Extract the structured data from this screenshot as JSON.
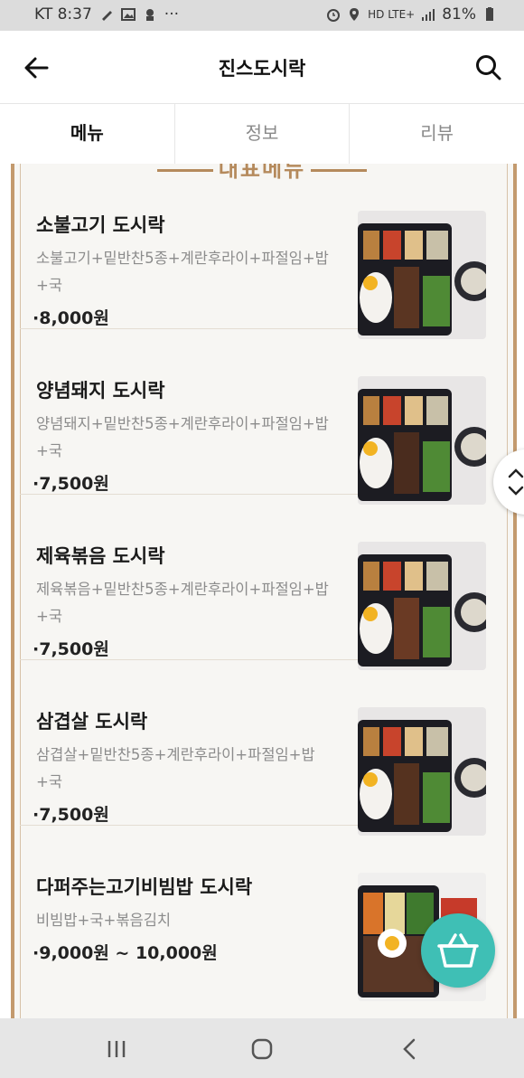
{
  "status_bar": {
    "carrier_time": "KT 8:37",
    "dots": "···",
    "network": "HD LTE+",
    "battery": "81%"
  },
  "header": {
    "title": "진스도시락"
  },
  "tabs": [
    {
      "label": "메뉴",
      "active": true
    },
    {
      "label": "정보",
      "active": false
    },
    {
      "label": "리뷰",
      "active": false
    }
  ],
  "section_banner": "대표메뉴",
  "menu_items": [
    {
      "name": "소불고기 도시락",
      "desc": "소불고기+밑반찬5종+계란후라이+파절임+밥+국",
      "price": "8,000원"
    },
    {
      "name": "양념돼지 도시락",
      "desc": "양념돼지+밑반찬5종+계란후라이+파절임+밥+국",
      "price": "7,500원"
    },
    {
      "name": "제육볶음 도시락",
      "desc": "제육볶음+밑반찬5종+계란후라이+파절임+밥+국",
      "price": "7,500원"
    },
    {
      "name": "삼겹살 도시락",
      "desc": "삼겹살+밑반찬5종+계란후라이+파절임+밥+국",
      "price": "7,500원"
    },
    {
      "name": "다퍼주는고기비빔밥 도시락",
      "desc": "비빔밥+국+볶음김치",
      "price": "9,000원 ~ 10,000원"
    }
  ],
  "colors": {
    "accent_gold": "#c39a6e",
    "fab_teal": "#3fbfb5"
  }
}
